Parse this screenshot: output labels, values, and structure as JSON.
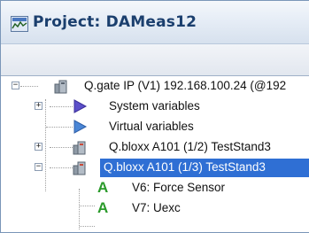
{
  "window": {
    "title": "Project: DAMeas12"
  },
  "tree": {
    "items": [
      {
        "label": "Q.gate IP (V1) 192.168.100.24 (@192",
        "icon": "device-icon",
        "expander": "−"
      },
      {
        "label": "System variables",
        "icon": "triangle-play-icon",
        "expander": "+"
      },
      {
        "label": "Virtual variables",
        "icon": "triangle-play-icon"
      },
      {
        "label": "Q.bloxx A101 (1/2) TestStand3",
        "icon": "device-icon",
        "expander": "+"
      },
      {
        "label": "Q.bloxx A101 (1/3) TestStand3",
        "icon": "device-icon",
        "expander": "−",
        "selected": true
      },
      {
        "label": "V6: Force Sensor",
        "icon": "analog-channel-icon",
        "glyph": "A"
      },
      {
        "label": "V7: Uexc",
        "icon": "analog-channel-icon",
        "glyph": "A"
      }
    ]
  },
  "colors": {
    "selection": "#2f6fd4",
    "title_text": "#1b3f6e",
    "channel_icon": "#2a9a2a"
  }
}
